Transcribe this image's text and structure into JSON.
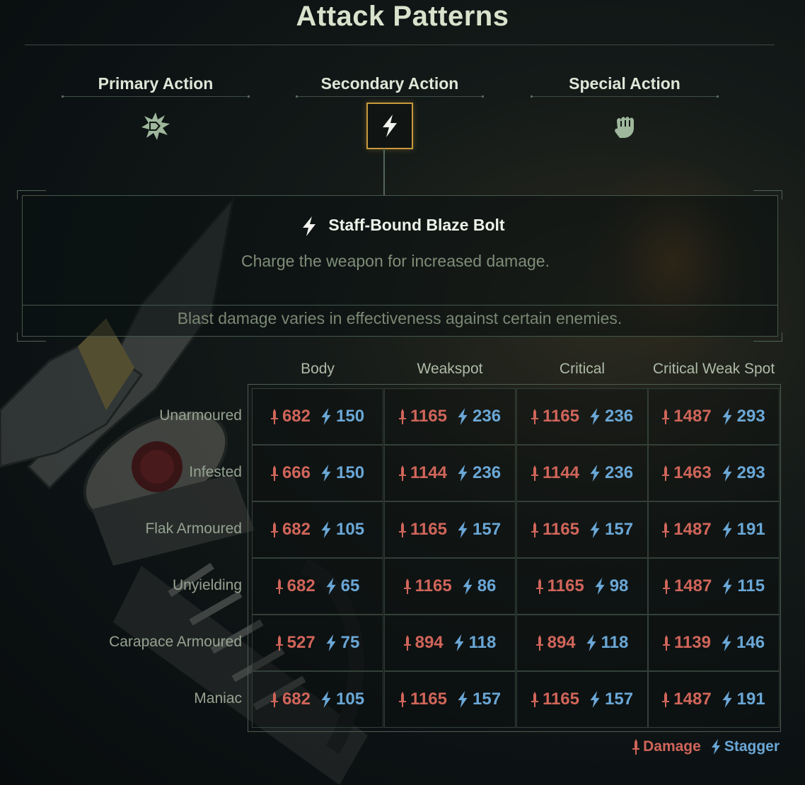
{
  "title": "Attack Patterns",
  "tabs": [
    {
      "label": "Primary Action",
      "icon": "impact-burst-icon",
      "active": false
    },
    {
      "label": "Secondary Action",
      "icon": "lightning-bolt-icon",
      "active": true
    },
    {
      "label": "Special Action",
      "icon": "fist-icon",
      "active": false
    }
  ],
  "attack": {
    "icon": "lightning-bolt-icon",
    "name": "Staff-Bound Blaze Bolt",
    "description": "Charge the weapon for increased damage.",
    "note": "Blast damage varies in effectiveness against certain enemies."
  },
  "columns": [
    "Body",
    "Weakspot",
    "Critical",
    "Critical Weak Spot"
  ],
  "rows": [
    {
      "label": "Unarmoured",
      "cells": [
        {
          "damage": "682",
          "stagger": "150"
        },
        {
          "damage": "1165",
          "stagger": "236"
        },
        {
          "damage": "1165",
          "stagger": "236"
        },
        {
          "damage": "1487",
          "stagger": "293"
        }
      ]
    },
    {
      "label": "Infested",
      "cells": [
        {
          "damage": "666",
          "stagger": "150"
        },
        {
          "damage": "1144",
          "stagger": "236"
        },
        {
          "damage": "1144",
          "stagger": "236"
        },
        {
          "damage": "1463",
          "stagger": "293"
        }
      ]
    },
    {
      "label": "Flak Armoured",
      "cells": [
        {
          "damage": "682",
          "stagger": "105"
        },
        {
          "damage": "1165",
          "stagger": "157"
        },
        {
          "damage": "1165",
          "stagger": "157"
        },
        {
          "damage": "1487",
          "stagger": "191"
        }
      ]
    },
    {
      "label": "Unyielding",
      "cells": [
        {
          "damage": "682",
          "stagger": "65"
        },
        {
          "damage": "1165",
          "stagger": "86"
        },
        {
          "damage": "1165",
          "stagger": "98"
        },
        {
          "damage": "1487",
          "stagger": "115"
        }
      ]
    },
    {
      "label": "Carapace Armoured",
      "cells": [
        {
          "damage": "527",
          "stagger": "75"
        },
        {
          "damage": "894",
          "stagger": "118"
        },
        {
          "damage": "894",
          "stagger": "118"
        },
        {
          "damage": "1139",
          "stagger": "146"
        }
      ]
    },
    {
      "label": "Maniac",
      "cells": [
        {
          "damage": "682",
          "stagger": "105"
        },
        {
          "damage": "1165",
          "stagger": "157"
        },
        {
          "damage": "1165",
          "stagger": "157"
        },
        {
          "damage": "1487",
          "stagger": "191"
        }
      ]
    }
  ],
  "legend": {
    "damage": "Damage",
    "stagger": "Stagger"
  },
  "colors": {
    "damage": "#d0655a",
    "stagger": "#6aa7d6",
    "active_border": "#c89a3c"
  }
}
